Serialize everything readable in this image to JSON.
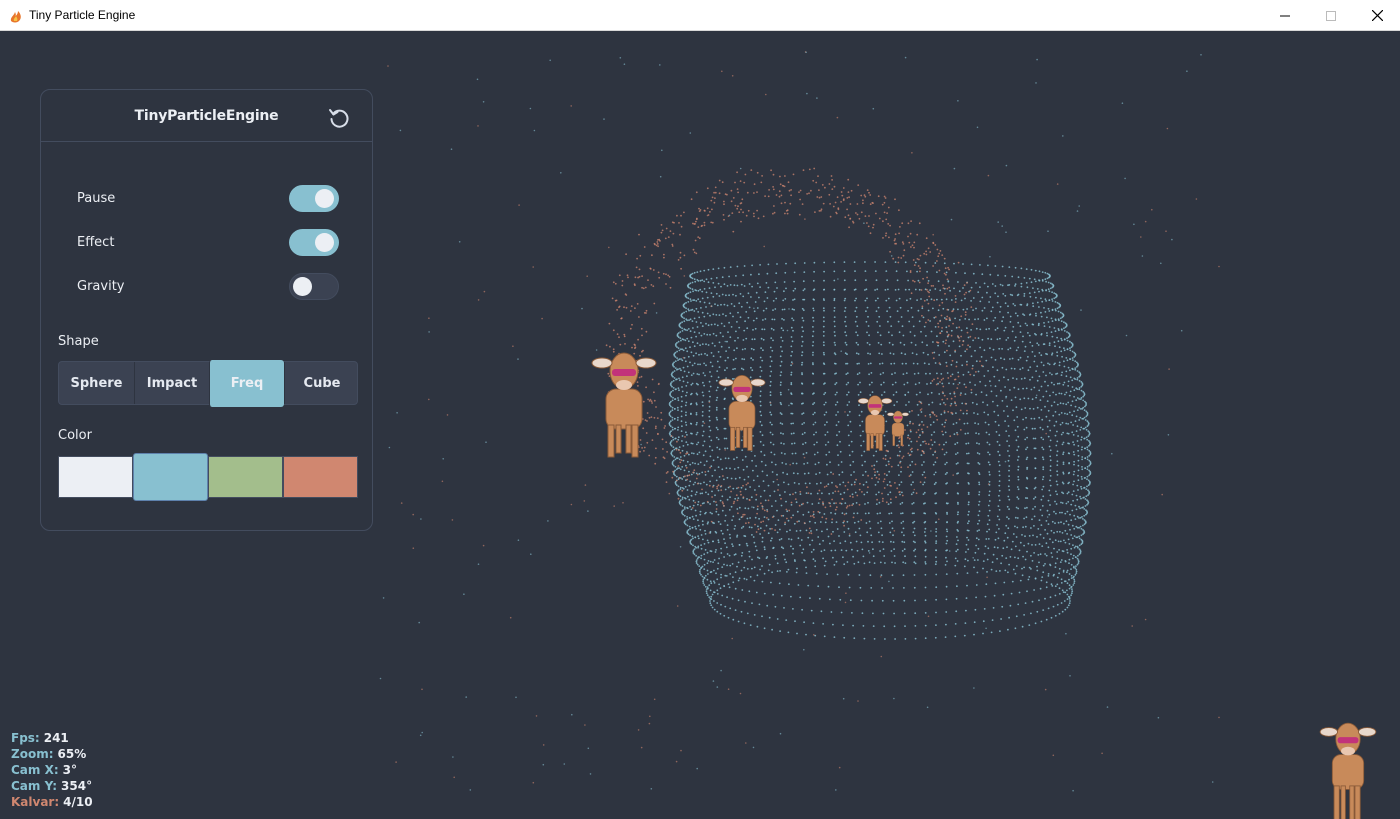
{
  "window": {
    "title": "Tiny Particle Engine"
  },
  "panel": {
    "title": "TinyParticleEngine",
    "toggles": [
      {
        "label": "Pause",
        "on": true
      },
      {
        "label": "Effect",
        "on": true
      },
      {
        "label": "Gravity",
        "on": false
      }
    ],
    "shape_label": "Shape",
    "shapes": [
      "Sphere",
      "Impact",
      "Freq",
      "Cube"
    ],
    "active_shape": "Freq",
    "color_label": "Color",
    "colors": [
      "#eceff4",
      "#88c0d0",
      "#a3be8c",
      "#d08770"
    ],
    "selected_color": "#88c0d0"
  },
  "stats": [
    {
      "key": "Fps:",
      "value": "241"
    },
    {
      "key": "Zoom:",
      "value": "65%"
    },
    {
      "key": "Cam X:",
      "value": "3°"
    },
    {
      "key": "Cam Y:",
      "value": "354°"
    },
    {
      "key": "Kalvar:",
      "value": "4/10"
    }
  ],
  "theme": {
    "background": "#2e3440",
    "accent": "#88c0d0",
    "particle_orange": "#d08770"
  }
}
